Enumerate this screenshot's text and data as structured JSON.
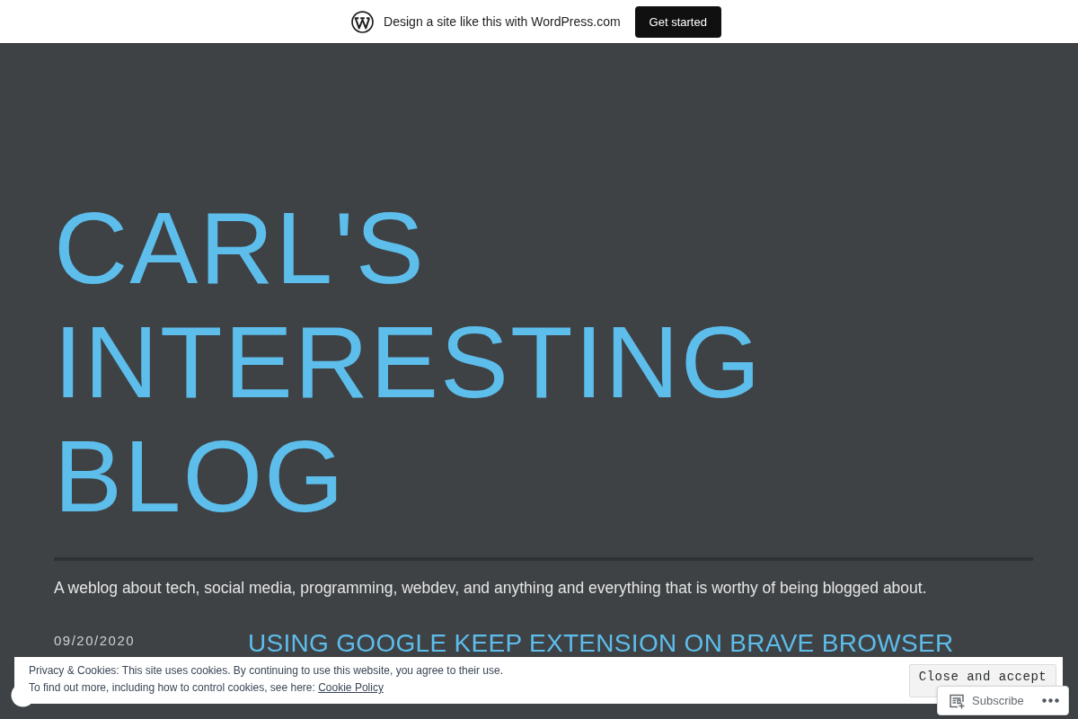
{
  "promo_bar": {
    "text": "Design a site like this with WordPress.com",
    "button": "Get started"
  },
  "site": {
    "title": "CARL'S INTERESTING BLOG",
    "tagline": "A weblog about tech, social media, programming, webdev, and anything and everything that is worthy of being blogged about."
  },
  "posts": [
    {
      "date": "09/20/2020",
      "title": "USING GOOGLE KEEP EXTENSION ON BRAVE BROWSER"
    }
  ],
  "cookie_banner": {
    "text": "Privacy & Cookies: This site uses cookies. By continuing to use this website, you agree to their use.",
    "more_text": "To find out more, including how to control cookies, see here:",
    "link": "Cookie Policy",
    "button": "Close and accept"
  },
  "subscribe_widget": {
    "label": "Subscribe"
  }
}
